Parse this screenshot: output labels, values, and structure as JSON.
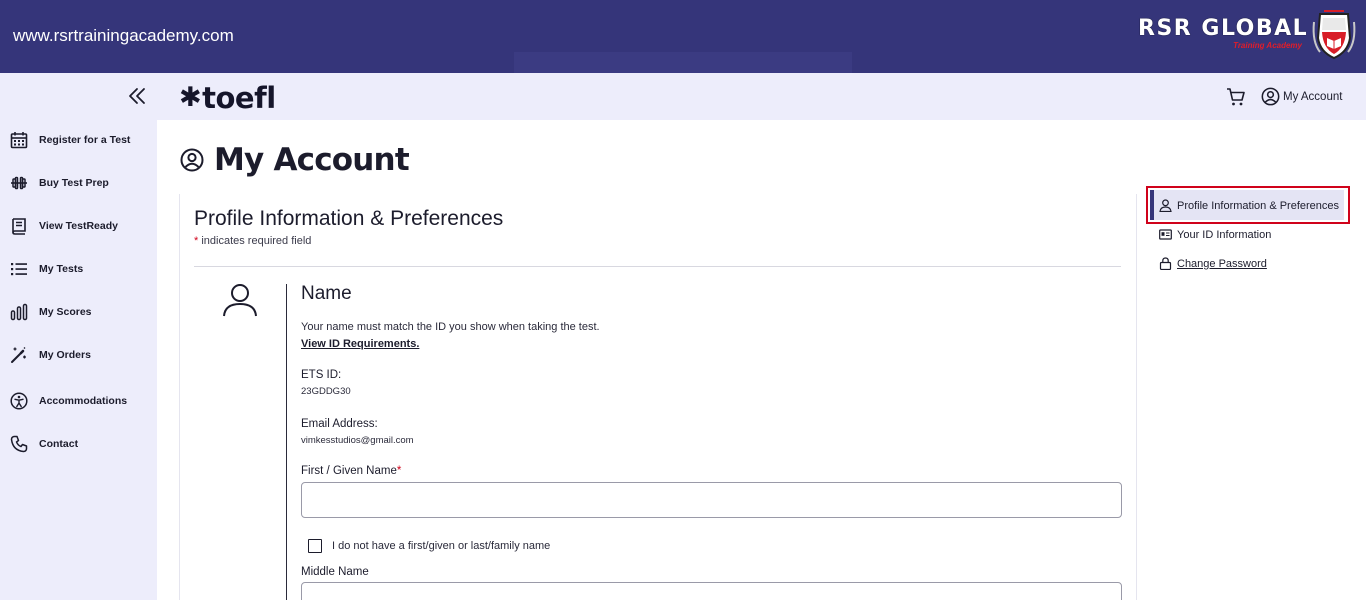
{
  "banner": {
    "url": "www.rsrtrainingacademy.com",
    "brand_name": "RSR GLOBAL",
    "brand_sub": "Training Academy"
  },
  "header": {
    "logo": "toefl",
    "account_label": "My Account"
  },
  "sidebar": {
    "items": [
      {
        "label": "Register for a Test",
        "icon": "calendar-icon"
      },
      {
        "label": "Buy Test Prep",
        "icon": "dumbbell-icon"
      },
      {
        "label": "View TestReady",
        "icon": "book-icon"
      },
      {
        "label": "My Tests",
        "icon": "list-icon"
      },
      {
        "label": "My Scores",
        "icon": "bar-chart-icon"
      },
      {
        "label": "My Orders",
        "icon": "magic-wand-icon"
      },
      {
        "label": "Accommodations",
        "icon": "accessibility-icon"
      },
      {
        "label": "Contact",
        "icon": "phone-icon"
      }
    ]
  },
  "main": {
    "page_title": "My Account",
    "section_title": "Profile Information & Preferences",
    "required_star": "*",
    "required_note": " indicates required field",
    "name": {
      "heading": "Name",
      "description": "Your name must match the ID you show when taking the test.",
      "id_link": "View ID Requirements.",
      "ets_id_label": "ETS ID:",
      "ets_id_value": "23GDDG30",
      "email_label": "Email Address:",
      "email_value": "vimkesstudios@gmail.com",
      "first_name_label": "First / Given Name",
      "first_name_value": "",
      "no_name_checkbox_label": "I do not have a first/given or last/family name",
      "middle_name_label": "Middle Name",
      "middle_name_value": ""
    }
  },
  "right_nav": {
    "items": [
      {
        "label": "Profile Information & Preferences",
        "active": true
      },
      {
        "label": "Your ID Information",
        "active": false
      },
      {
        "label": "Change Password",
        "active": false
      }
    ]
  },
  "colors": {
    "banner": "#35357a",
    "nav_bg": "#ededfb",
    "highlight_border": "#d0021b",
    "required": "#d0021b"
  }
}
